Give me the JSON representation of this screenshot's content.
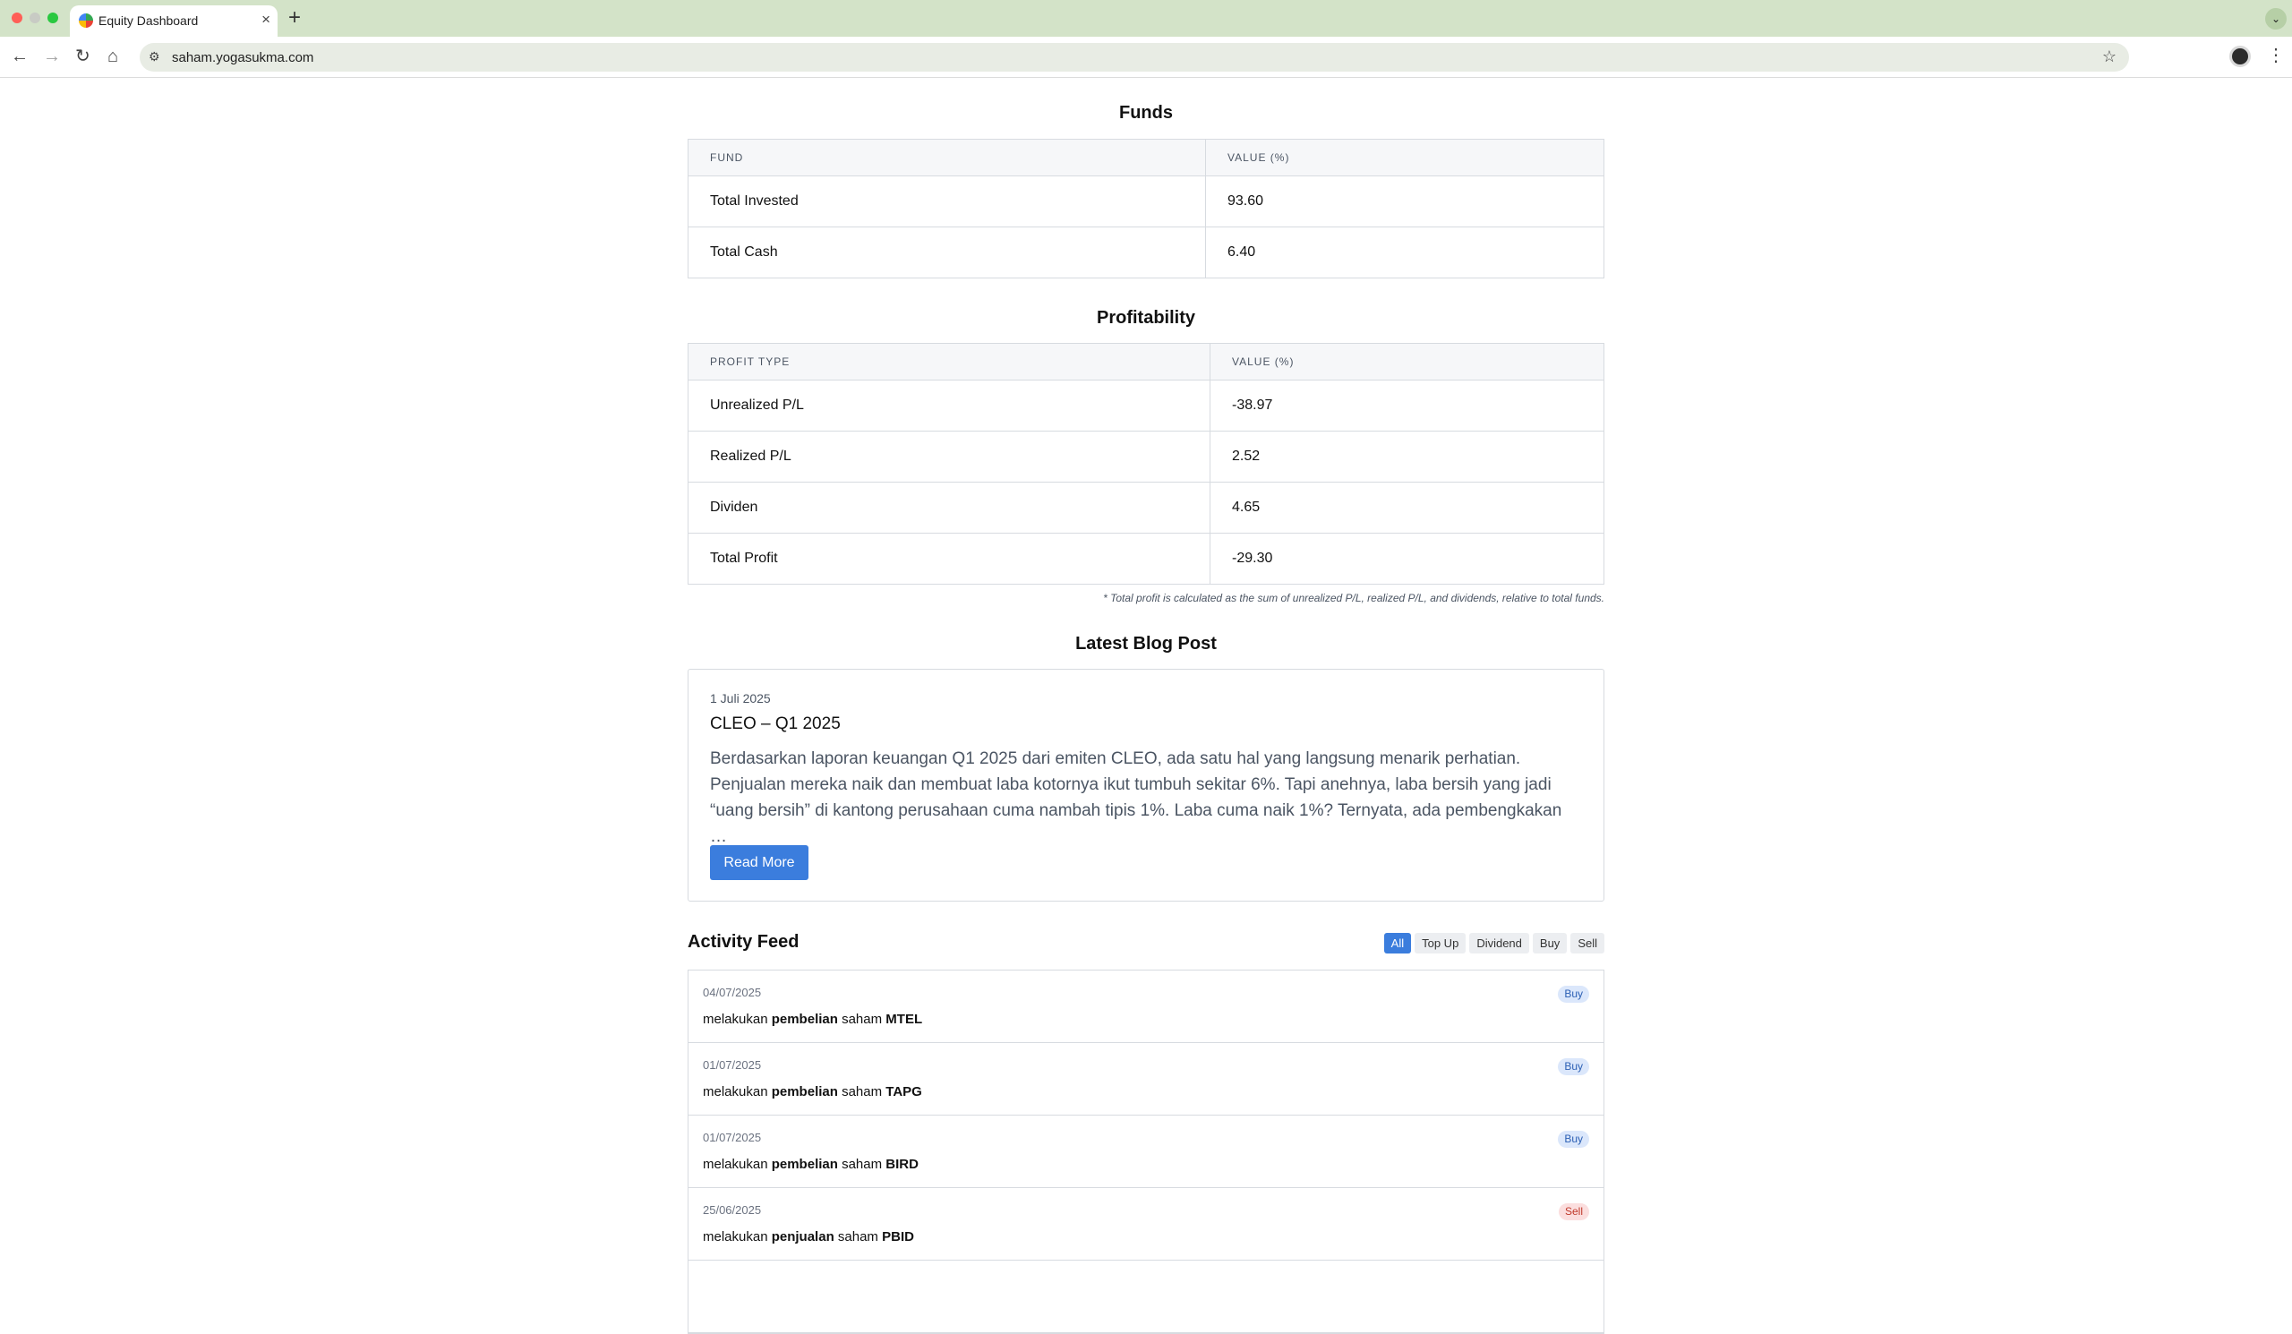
{
  "browser": {
    "tab_title": "Equity Dashboard",
    "url": "saham.yogasukma.com",
    "new_tab_symbol": "+",
    "close_symbol": "×"
  },
  "funds": {
    "title": "Funds",
    "headers": [
      "FUND",
      "VALUE (%)"
    ],
    "rows": [
      {
        "label": "Total Invested",
        "value": "93.60"
      },
      {
        "label": "Total Cash",
        "value": "6.40"
      }
    ]
  },
  "profitability": {
    "title": "Profitability",
    "headers": [
      "PROFIT TYPE",
      "VALUE (%)"
    ],
    "rows": [
      {
        "label": "Unrealized P/L",
        "value": "-38.97"
      },
      {
        "label": "Realized P/L",
        "value": "2.52"
      },
      {
        "label": "Dividen",
        "value": "4.65"
      },
      {
        "label": "Total Profit",
        "value": "-29.30"
      }
    ],
    "footnote": "* Total profit is calculated as the sum of unrealized P/L, realized P/L, and dividends, relative to total funds."
  },
  "blog": {
    "section_title": "Latest Blog Post",
    "date": "1 Juli 2025",
    "title": "CLEO – Q1 2025",
    "excerpt": "Berdasarkan laporan keuangan Q1 2025 dari emiten CLEO, ada satu hal yang langsung menarik perhatian. Penjualan mereka naik dan membuat laba kotornya ikut tumbuh sekitar 6%. Tapi anehnya, laba bersih yang jadi “uang bersih” di kantong perusahaan cuma nambah tipis 1%. Laba cuma naik 1%? Ternyata, ada pembengkakan …",
    "read_more": "Read More"
  },
  "activity": {
    "title": "Activity Feed",
    "filters": [
      "All",
      "Top Up",
      "Dividend",
      "Buy",
      "Sell"
    ],
    "active_filter": "All",
    "items": [
      {
        "date": "04/07/2025",
        "prefix": "melakukan",
        "action": "pembelian",
        "middle": "saham",
        "ticker": "MTEL",
        "badge": "Buy",
        "type": "buy"
      },
      {
        "date": "01/07/2025",
        "prefix": "melakukan",
        "action": "pembelian",
        "middle": "saham",
        "ticker": "TAPG",
        "badge": "Buy",
        "type": "buy"
      },
      {
        "date": "01/07/2025",
        "prefix": "melakukan",
        "action": "pembelian",
        "middle": "saham",
        "ticker": "BIRD",
        "badge": "Buy",
        "type": "buy"
      },
      {
        "date": "25/06/2025",
        "prefix": "melakukan",
        "action": "penjualan",
        "middle": "saham",
        "ticker": "PBID",
        "badge": "Sell",
        "type": "sell"
      }
    ]
  }
}
